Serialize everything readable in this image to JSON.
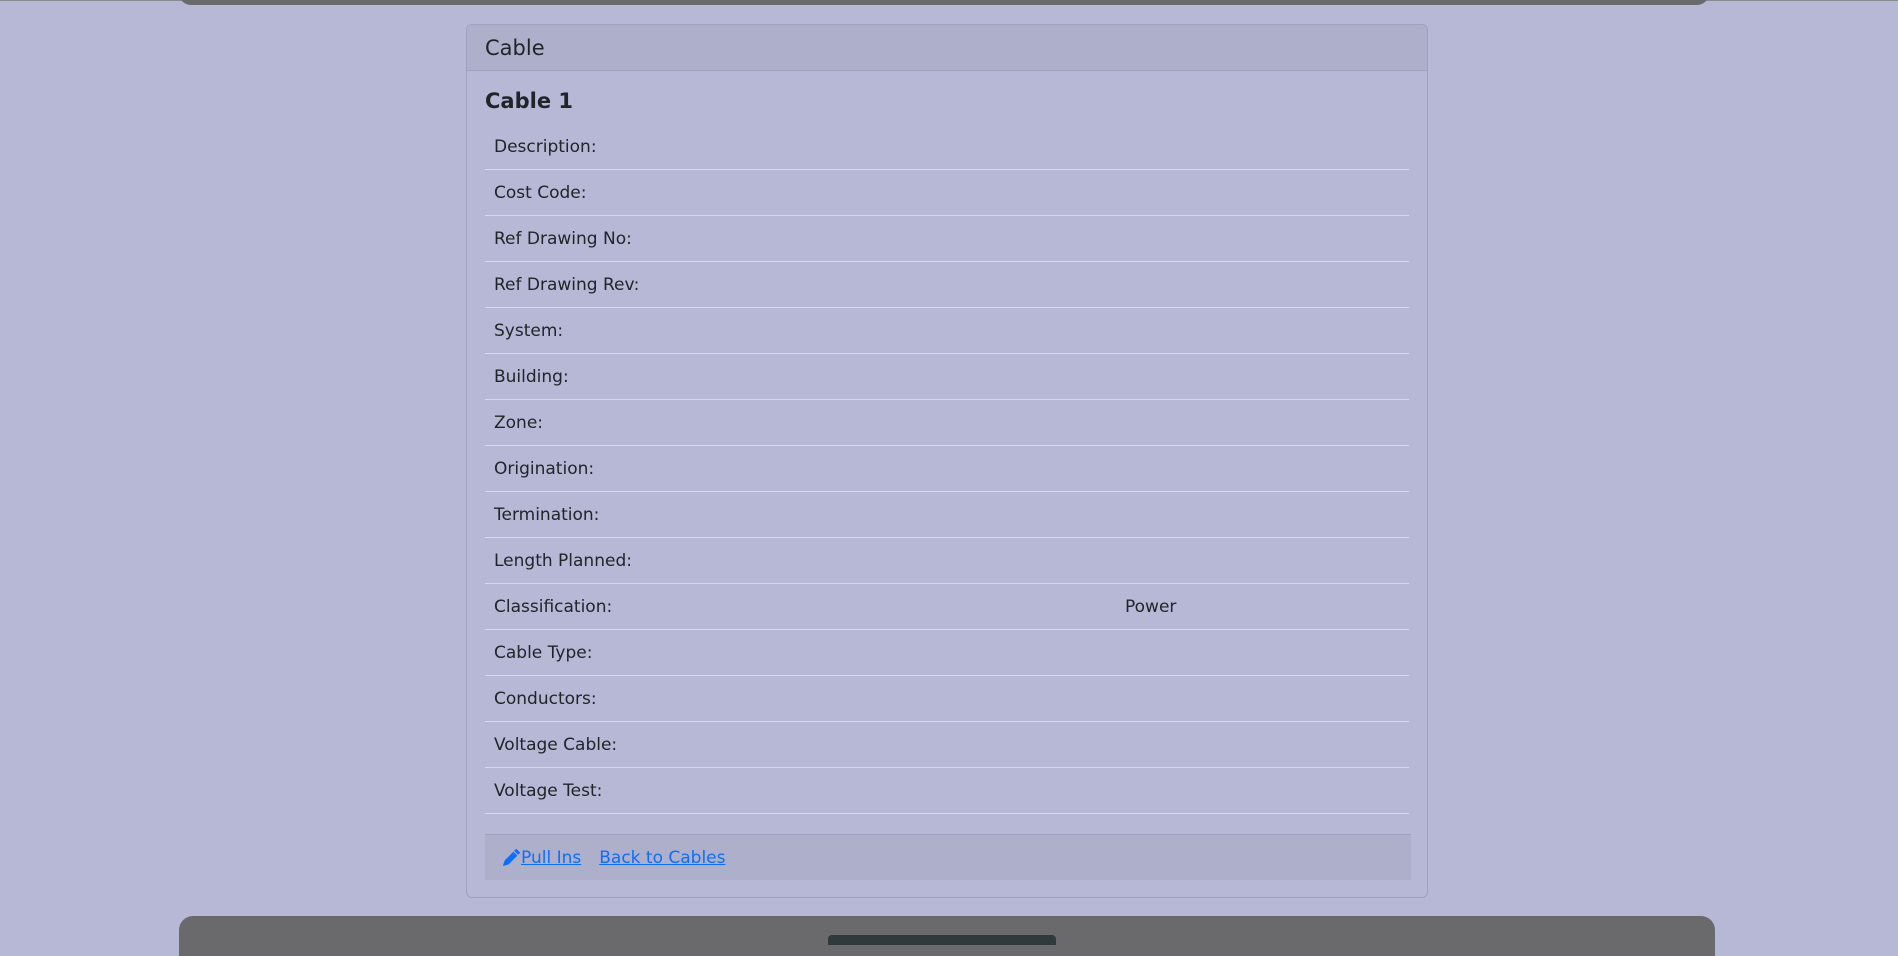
{
  "card": {
    "header": "Cable",
    "title": "Cable 1",
    "fields": [
      {
        "label": "Description:",
        "value": ""
      },
      {
        "label": "Cost Code:",
        "value": ""
      },
      {
        "label": "Ref Drawing No:",
        "value": ""
      },
      {
        "label": "Ref Drawing Rev:",
        "value": ""
      },
      {
        "label": "System:",
        "value": ""
      },
      {
        "label": "Building:",
        "value": ""
      },
      {
        "label": "Zone:",
        "value": ""
      },
      {
        "label": "Origination:",
        "value": ""
      },
      {
        "label": "Termination:",
        "value": ""
      },
      {
        "label": "Length Planned:",
        "value": ""
      },
      {
        "label": "Classification:",
        "value": "Power"
      },
      {
        "label": "Cable Type:",
        "value": ""
      },
      {
        "label": "Conductors:",
        "value": ""
      },
      {
        "label": "Voltage Cable:",
        "value": ""
      },
      {
        "label": "Voltage Test:",
        "value": ""
      }
    ],
    "footer": {
      "pull_ins_label": "Pull Ins",
      "pull_ins_icon": "pencil-icon",
      "back_label": "Back to Cables"
    }
  },
  "colors": {
    "page_background": "#b6b8d6",
    "link": "#0d6efd",
    "bar": "#6a6a6c"
  }
}
